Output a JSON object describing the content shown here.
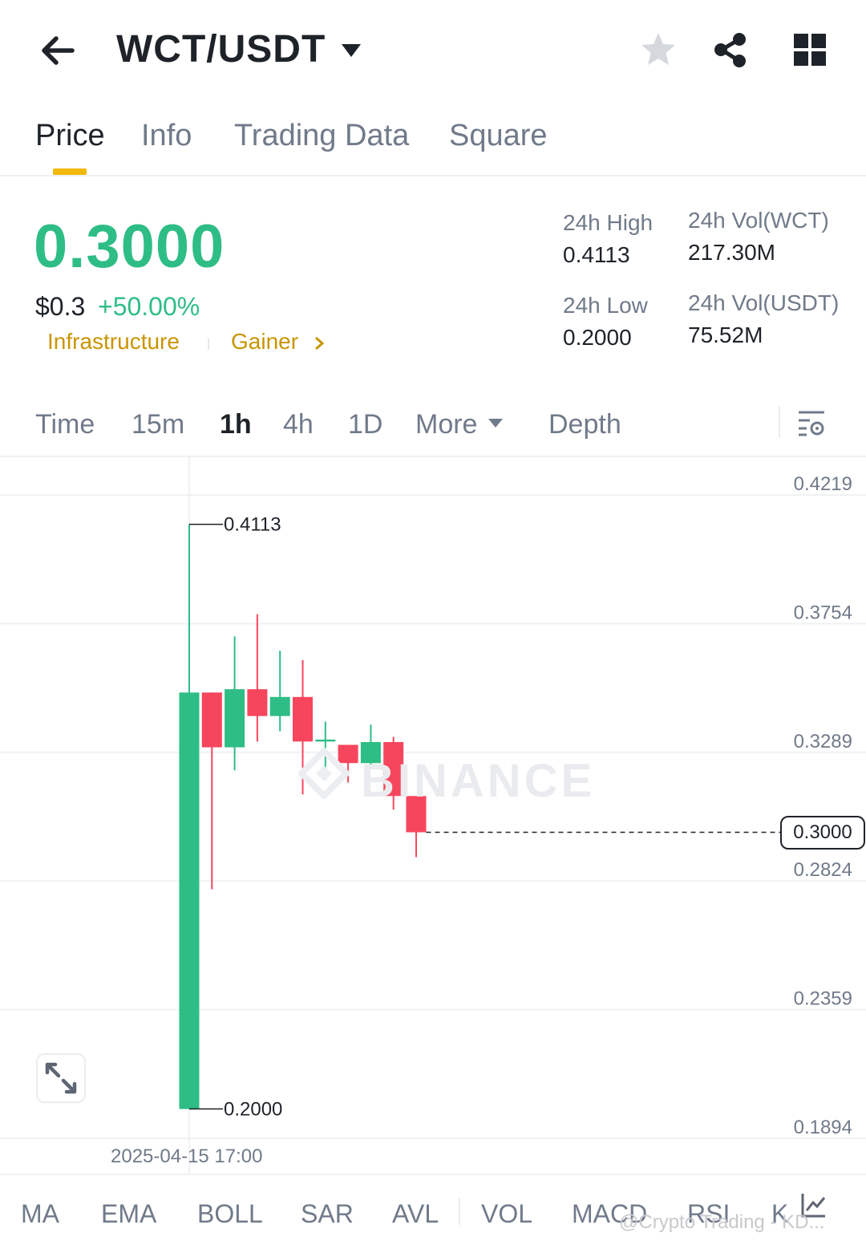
{
  "header": {
    "pair": "WCT/USDT",
    "icons": [
      "back-arrow-icon",
      "caret-down-icon",
      "star-icon",
      "share-icon",
      "grid-icon"
    ]
  },
  "tabs": [
    {
      "label": "Price",
      "active": true
    },
    {
      "label": "Info",
      "active": false
    },
    {
      "label": "Trading Data",
      "active": false
    },
    {
      "label": "Square",
      "active": false
    }
  ],
  "ticker": {
    "last_price": "0.3000",
    "usd_price": "$0.3",
    "change": "+50.00%",
    "tags": [
      "Infrastructure",
      "Gainer"
    ],
    "stats": {
      "high_label": "24h High",
      "high": "0.4113",
      "low_label": "24h Low",
      "low": "0.2000",
      "vol_base_label": "24h Vol(WCT)",
      "vol_base": "217.30M",
      "vol_quote_label": "24h Vol(USDT)",
      "vol_quote": "75.52M"
    }
  },
  "intervals": {
    "items": [
      "Time",
      "15m",
      "1h",
      "4h",
      "1D",
      "More",
      "Depth"
    ],
    "active": "1h"
  },
  "chart_data": {
    "type": "candlestick",
    "interval": "1h",
    "x_label": "2025-04-15 17:00",
    "y_ticks": [
      "0.4219",
      "0.3754",
      "0.3289",
      "0.2824",
      "0.2359",
      "0.1894"
    ],
    "ylim": [
      0.1894,
      0.4219
    ],
    "last_price": "0.3000",
    "high_marker": "0.4113",
    "low_marker": "0.2000",
    "colors": {
      "up": "#2ebd85",
      "down": "#f6465d"
    },
    "candles": [
      {
        "o": 0.2,
        "h": 0.4113,
        "l": 0.2,
        "c": 0.3505
      },
      {
        "o": 0.3505,
        "h": 0.3505,
        "l": 0.2794,
        "c": 0.3307
      },
      {
        "o": 0.3307,
        "h": 0.3708,
        "l": 0.3224,
        "c": 0.3517
      },
      {
        "o": 0.3517,
        "h": 0.3788,
        "l": 0.3328,
        "c": 0.342
      },
      {
        "o": 0.342,
        "h": 0.3656,
        "l": 0.3365,
        "c": 0.3489
      },
      {
        "o": 0.3489,
        "h": 0.3622,
        "l": 0.3137,
        "c": 0.3328
      },
      {
        "o": 0.3328,
        "h": 0.34,
        "l": 0.319,
        "c": 0.3335
      },
      {
        "o": 0.3316,
        "h": 0.3316,
        "l": 0.318,
        "c": 0.325
      },
      {
        "o": 0.325,
        "h": 0.3389,
        "l": 0.3244,
        "c": 0.3326
      },
      {
        "o": 0.3326,
        "h": 0.3345,
        "l": 0.3082,
        "c": 0.3131
      },
      {
        "o": 0.3131,
        "h": 0.3131,
        "l": 0.291,
        "c": 0.3
      }
    ]
  },
  "watermark": "BINANCE",
  "indicators": [
    "MA",
    "EMA",
    "BOLL",
    "SAR",
    "AVL",
    "VOL",
    "MACD",
    "RSI",
    "K"
  ],
  "credit": "@Crypto Trading - KD..."
}
